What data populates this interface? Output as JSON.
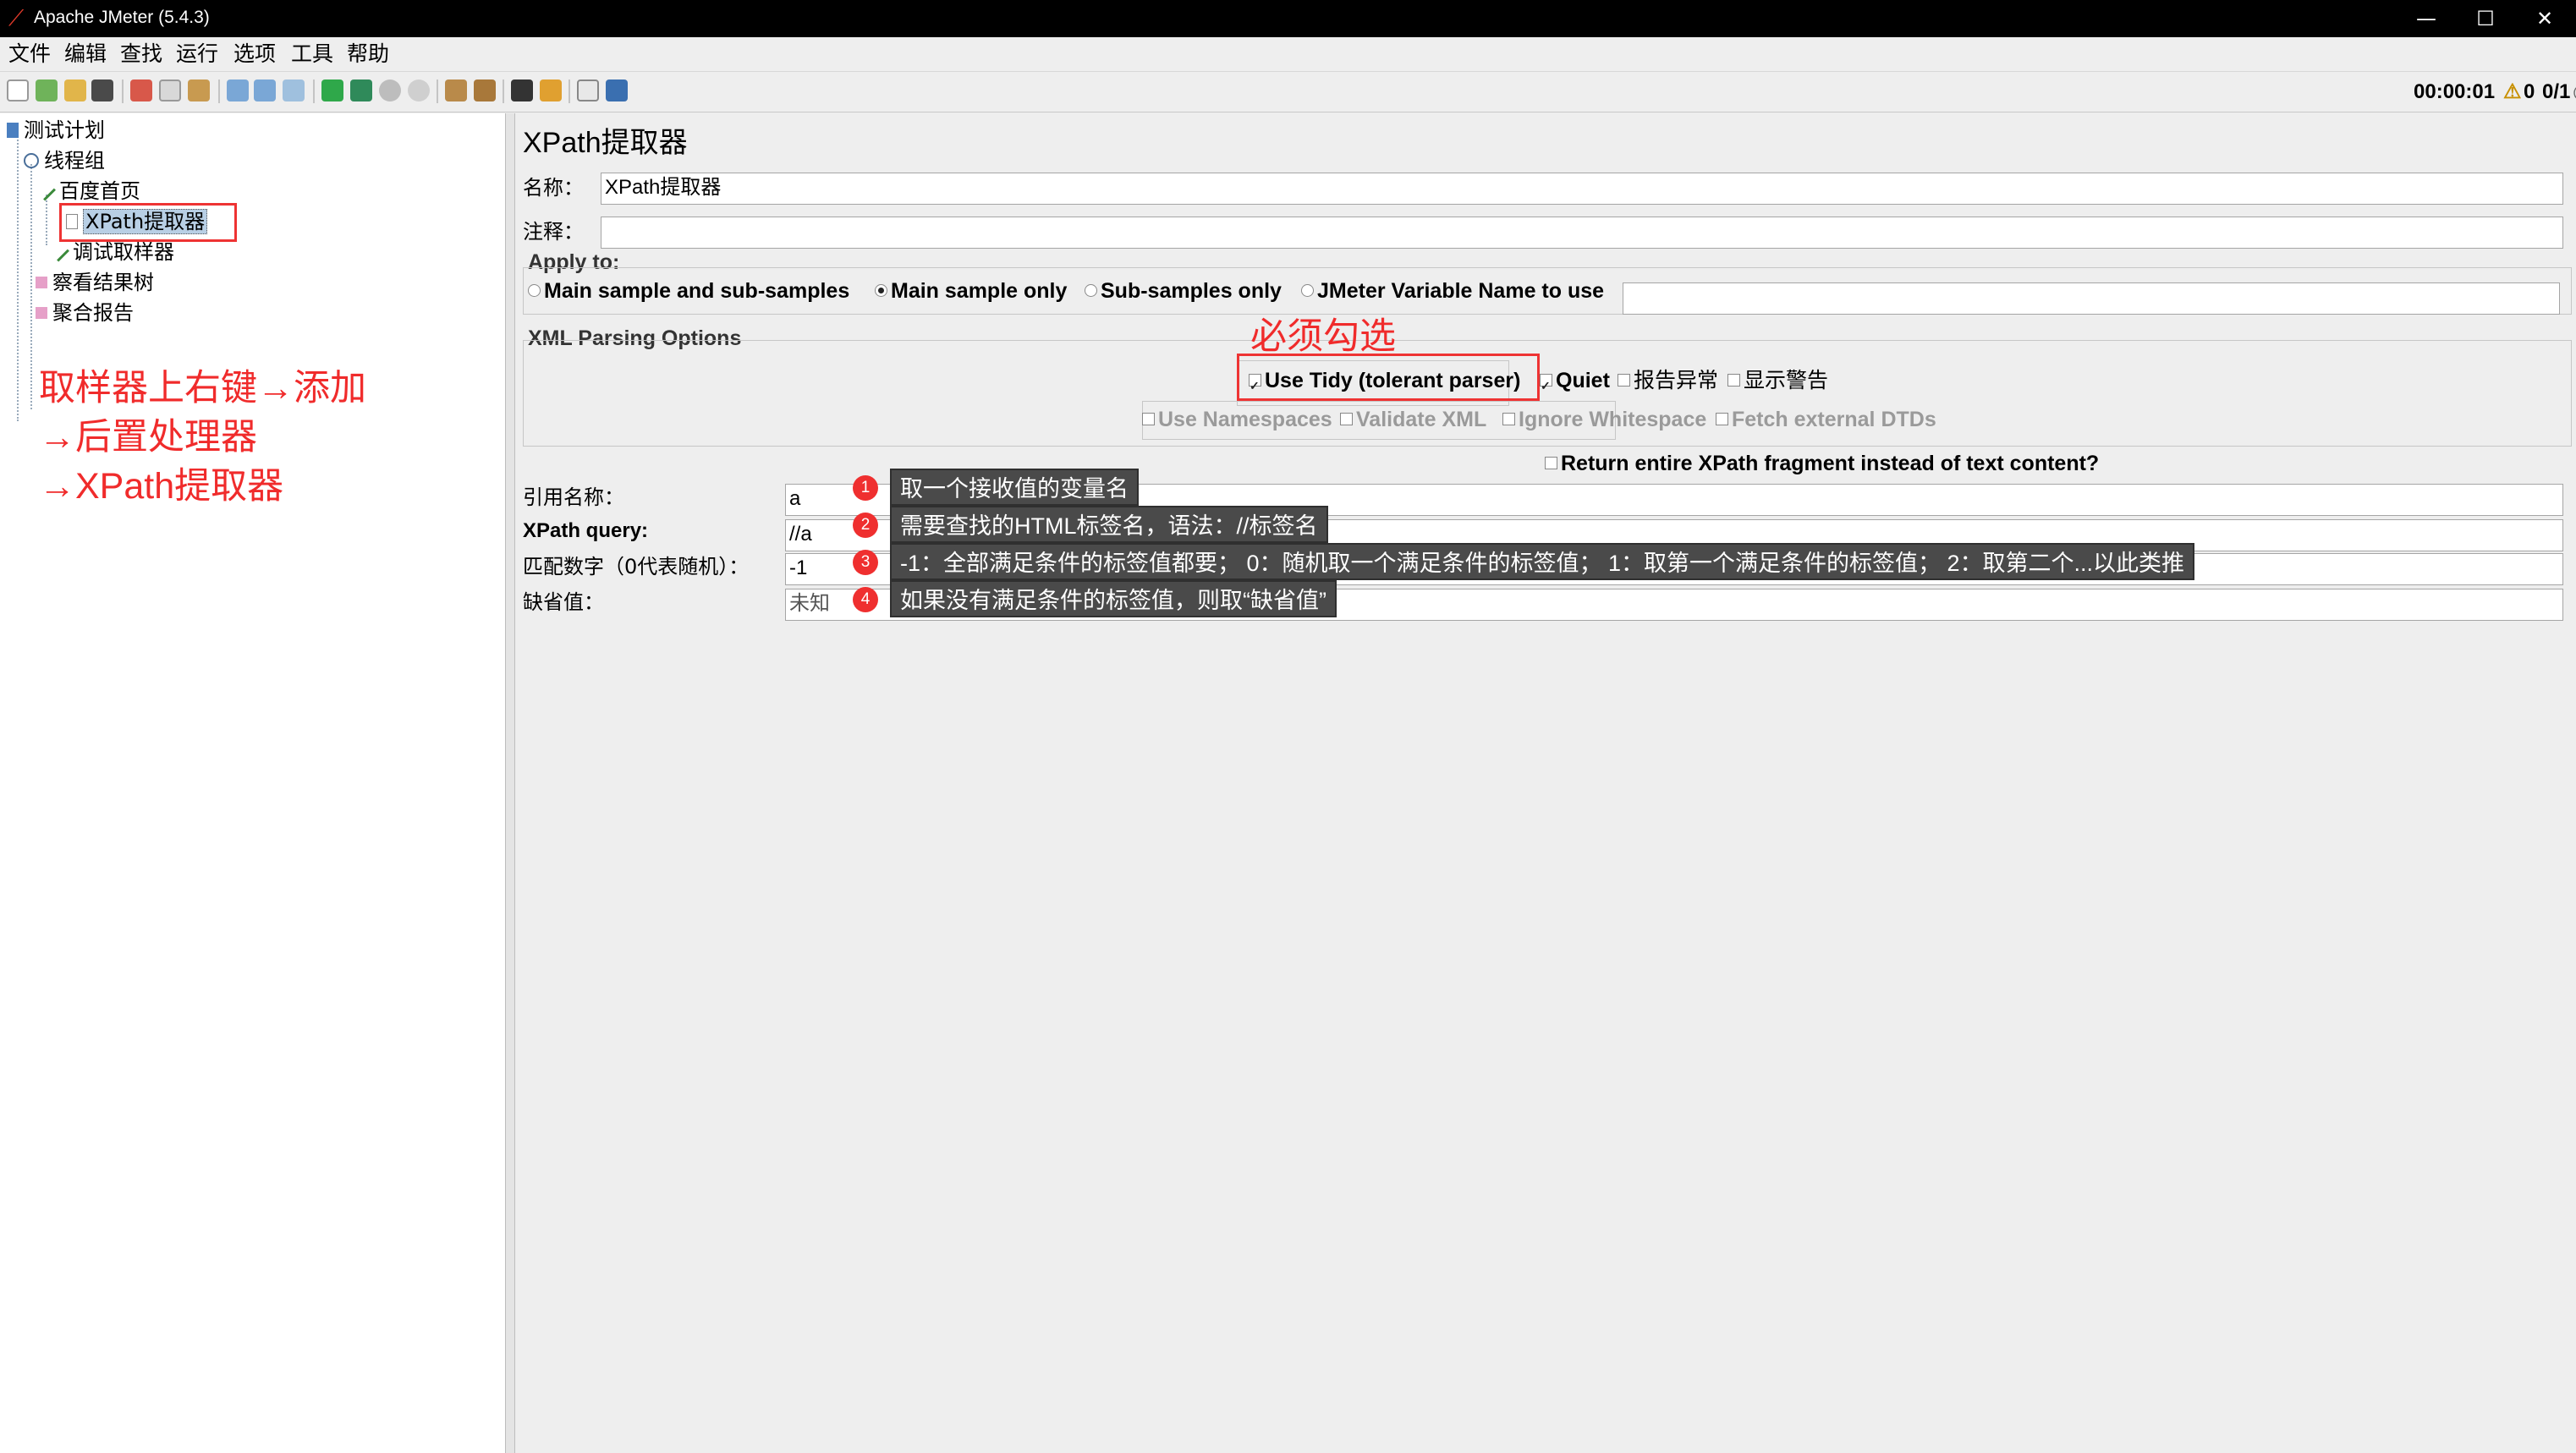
{
  "window": {
    "title": "Apache JMeter (5.4.3)",
    "minimize": "—",
    "maximize": "☐",
    "close": "✕"
  },
  "menu": [
    "文件",
    "编辑",
    "查找",
    "运行",
    "选项",
    "工具",
    "帮助"
  ],
  "status": {
    "elapsed": "00:00:01",
    "warnings": "0",
    "threads": "0/1",
    "warning_icon": "⚠",
    "indicator_icon": "◎"
  },
  "tree": {
    "items": [
      {
        "label": "测试计划",
        "icon": "test-plan-icon"
      },
      {
        "label": "线程组",
        "icon": "thread-group-icon"
      },
      {
        "label": "百度首页",
        "icon": "sampler-icon"
      },
      {
        "label": "XPath提取器",
        "icon": "post-processor-icon"
      },
      {
        "label": "调试取样器",
        "icon": "sampler-icon"
      },
      {
        "label": "察看结果树",
        "icon": "listener-icon"
      },
      {
        "label": "聚合报告",
        "icon": "listener-icon"
      }
    ],
    "note_lines": [
      "取样器上右键→添加",
      "→后置处理器",
      "→XPath提取器"
    ]
  },
  "panel": {
    "title": "XPath提取器",
    "name_label": "名称：",
    "name_value": "XPath提取器",
    "comment_label": "注释：",
    "comment_value": "",
    "apply_to": {
      "title": "Apply to:",
      "options": [
        "Main sample and sub-samples",
        "Main sample only",
        "Sub-samples only",
        "JMeter Variable Name to use"
      ],
      "selected": "Main sample only",
      "variable_value": ""
    },
    "xml_parsing": {
      "title": "XML Parsing Options",
      "must_check_note": "必须勾选",
      "use_tidy": "Use Tidy (tolerant parser)",
      "quiet": "Quiet",
      "report_errors": "报告异常",
      "show_warnings": "显示警告",
      "use_namespaces": "Use Namespaces",
      "validate_xml": "Validate XML",
      "ignore_whitespace": "Ignore Whitespace",
      "fetch_dtds": "Fetch external DTDs"
    },
    "return_fragment": "Return entire XPath fragment instead of text content?",
    "fields": [
      {
        "label": "引用名称：",
        "value": "a",
        "badge": "1",
        "tip": "取一个接收值的变量名"
      },
      {
        "label": "XPath query:",
        "value": "//a",
        "badge": "2",
        "tip": "需要查找的HTML标签名，语法：//标签名"
      },
      {
        "label": "匹配数字（0代表随机）：",
        "value": "-1",
        "badge": "3",
        "tip": "-1：全部满足条件的标签值都要；   0：随机取一个满足条件的标签值；   1：取第一个满足条件的标签值；   2：取第二个...以此类推"
      },
      {
        "label": "缺省值：",
        "value": "未知",
        "badge": "4",
        "tip": "如果没有满足条件的标签值，则取“缺省值”"
      }
    ]
  }
}
